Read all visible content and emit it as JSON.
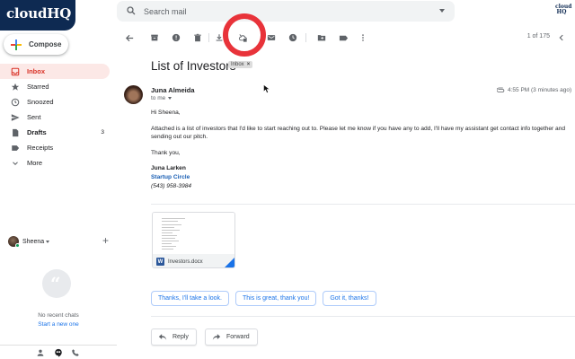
{
  "brand": {
    "logo_text": "cloudHQ",
    "corner_logo_text": "cloud HQ"
  },
  "search": {
    "placeholder": "Search mail"
  },
  "sidebar": {
    "compose_label": "Compose",
    "items": [
      {
        "label": "Inbox",
        "icon": "inbox-icon",
        "active": true,
        "count": ""
      },
      {
        "label": "Starred",
        "icon": "star-icon",
        "count": ""
      },
      {
        "label": "Snoozed",
        "icon": "clock-icon",
        "count": ""
      },
      {
        "label": "Sent",
        "icon": "send-icon",
        "count": ""
      },
      {
        "label": "Drafts",
        "icon": "draft-icon",
        "count": "3",
        "bold": true
      },
      {
        "label": "Receipts",
        "icon": "label-icon",
        "count": ""
      },
      {
        "label": "More",
        "icon": "chevron-down-icon",
        "count": ""
      }
    ],
    "hangouts": {
      "user_name": "Sheena",
      "empty_text": "No recent chats",
      "start_link": "Start a new one"
    }
  },
  "toolbar": {
    "pager_text": "1 of 175",
    "icons": [
      "back-arrow-icon",
      "archive-icon",
      "report-spam-icon",
      "delete-icon",
      "download-icon",
      "save-to-cloud-icon",
      "mark-unread-icon",
      "snooze-icon",
      "move-to-icon",
      "labels-icon",
      "more-vert-icon"
    ]
  },
  "message": {
    "subject": "List of Investors",
    "label_chip": "Inbox",
    "sender_name": "Juna Almeida",
    "to_text": "to me",
    "time": "4:55 PM (3 minutes ago)",
    "greeting": "Hi Sheena,",
    "body_line1": "Attached is a list of investors that I'd like to start reaching out to. Please let me know if you have any to add, I'll have my assistant get contact info together and",
    "body_line2": "sending out our pitch.",
    "signoff": "Thank you,",
    "sig_name": "Juna Larken",
    "sig_company": "Startup Circle",
    "sig_phone": "(543) 958-3984",
    "attachment_name": "Investors.docx",
    "attachment_badge": "W"
  },
  "smart_replies": [
    "Thanks, I'll take a look.",
    "This is great, thank you!",
    "Got it, thanks!"
  ],
  "actions": {
    "reply_label": "Reply",
    "forward_label": "Forward"
  },
  "colors": {
    "accent_red": "#e8333a",
    "link_blue": "#1a73e8",
    "inbox_active_bg": "#fce8e6",
    "brand_navy": "#0e2a52"
  }
}
